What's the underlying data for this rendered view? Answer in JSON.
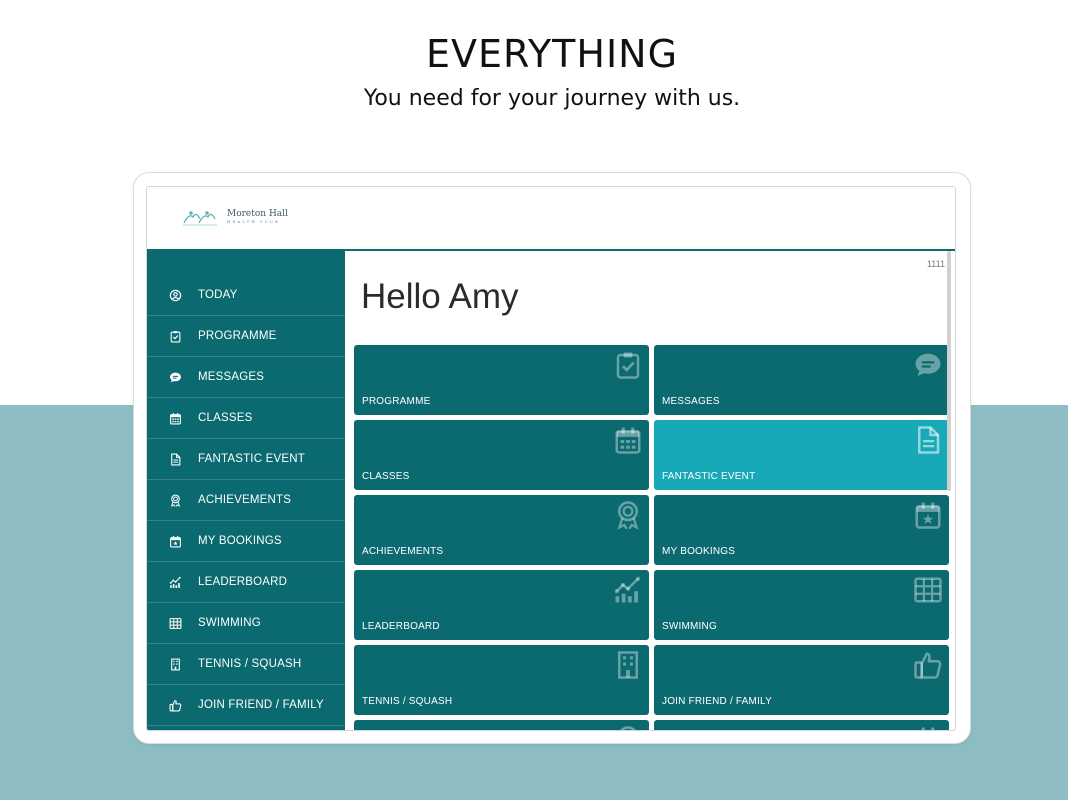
{
  "hero": {
    "title": "EVERYTHING",
    "subtitle": "You need for your journey with us."
  },
  "brand": {
    "logo_name": "Moreton Hall",
    "logo_sub": "HEALTH CLUB",
    "accent": "#0b6a70",
    "highlight": "#18a9b8",
    "band": "#8dbdc2"
  },
  "version": "1111",
  "greeting": "Hello Amy",
  "sidebar": {
    "items": [
      {
        "label": "TODAY",
        "icon": "user-circle-icon"
      },
      {
        "label": "PROGRAMME",
        "icon": "clipboard-check-icon"
      },
      {
        "label": "MESSAGES",
        "icon": "comment-icon"
      },
      {
        "label": "CLASSES",
        "icon": "calendar-icon"
      },
      {
        "label": "FANTASTIC EVENT",
        "icon": "document-icon"
      },
      {
        "label": "ACHIEVEMENTS",
        "icon": "award-icon"
      },
      {
        "label": "MY BOOKINGS",
        "icon": "calendar-star-icon"
      },
      {
        "label": "LEADERBOARD",
        "icon": "chart-icon"
      },
      {
        "label": "SWIMMING",
        "icon": "grid-icon"
      },
      {
        "label": "TENNIS / SQUASH",
        "icon": "building-icon"
      },
      {
        "label": "JOIN FRIEND / FAMILY",
        "icon": "thumbs-up-icon"
      }
    ]
  },
  "tiles": [
    {
      "label": "PROGRAMME",
      "icon": "clipboard-check-icon"
    },
    {
      "label": "MESSAGES",
      "icon": "comment-icon"
    },
    {
      "label": "CLASSES",
      "icon": "calendar-icon"
    },
    {
      "label": "FANTASTIC EVENT",
      "icon": "document-icon"
    },
    {
      "label": "ACHIEVEMENTS",
      "icon": "award-icon"
    },
    {
      "label": "MY BOOKINGS",
      "icon": "calendar-star-icon"
    },
    {
      "label": "LEADERBOARD",
      "icon": "chart-icon"
    },
    {
      "label": "SWIMMING",
      "icon": "grid-icon"
    },
    {
      "label": "TENNIS / SQUASH",
      "icon": "building-icon"
    },
    {
      "label": "JOIN FRIEND / FAMILY",
      "icon": "thumbs-up-icon"
    },
    {
      "label": "",
      "icon": "award-icon"
    },
    {
      "label": "",
      "icon": "calendar-icon"
    }
  ]
}
